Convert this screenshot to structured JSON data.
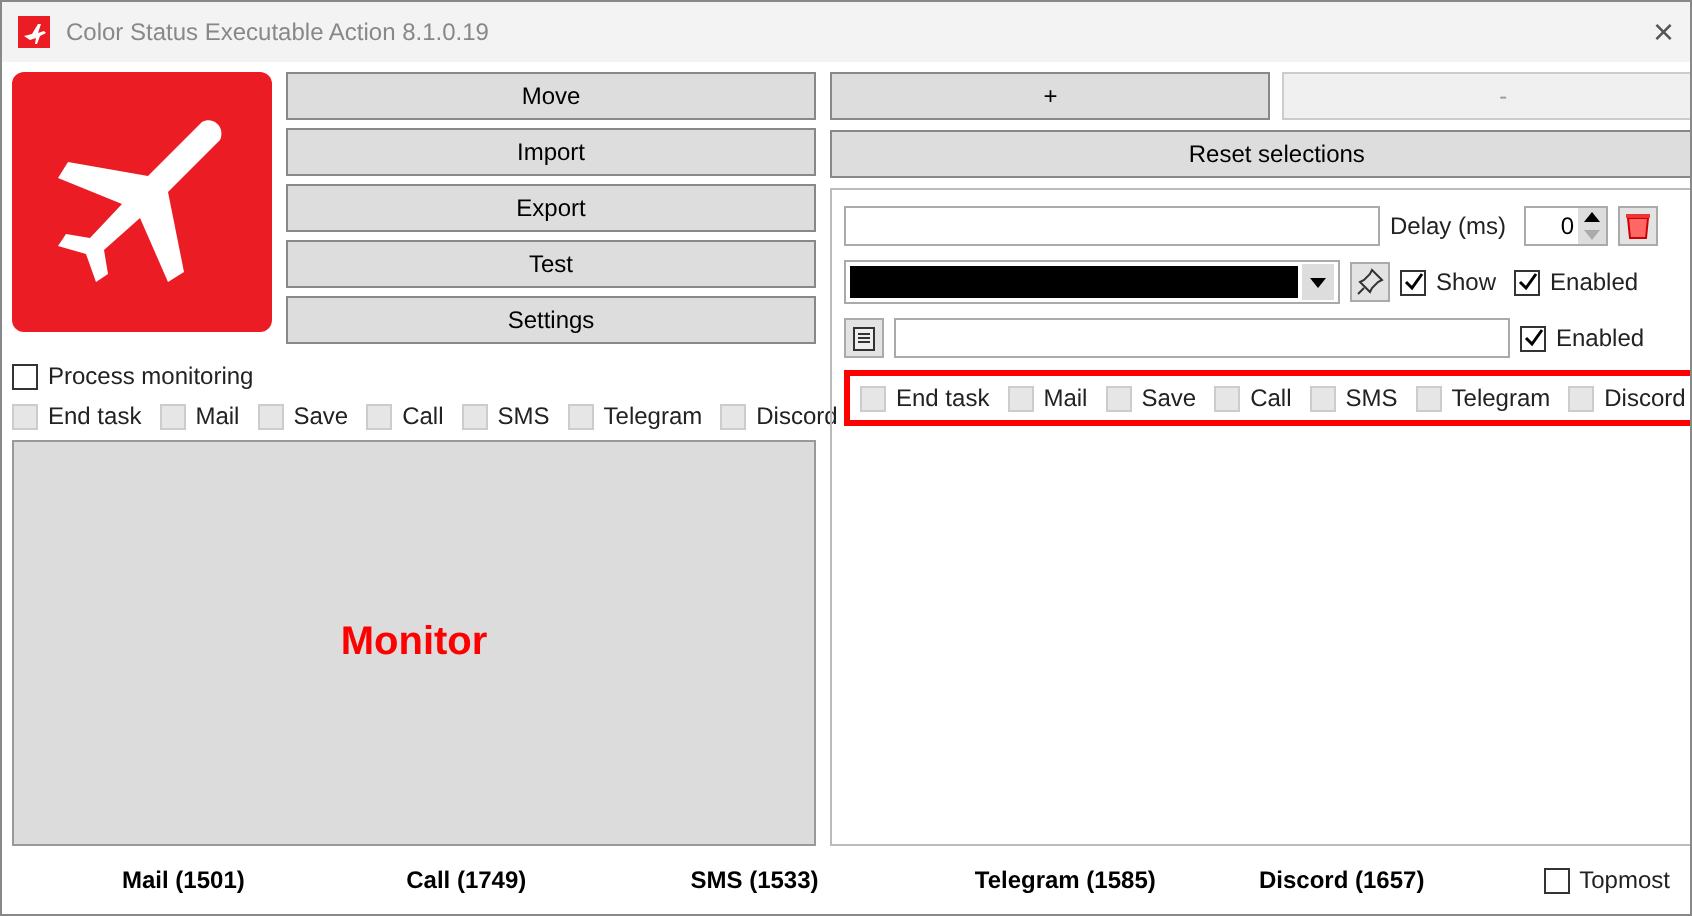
{
  "window": {
    "title": "Color Status Executable Action 8.1.0.19",
    "close": "×"
  },
  "buttons": [
    {
      "label": "Move"
    },
    {
      "label": "Import"
    },
    {
      "label": "Export"
    },
    {
      "label": "Test"
    },
    {
      "label": "Settings"
    }
  ],
  "process_monitoring": {
    "label": "Process monitoring",
    "checked": false
  },
  "left_channels": [
    {
      "label": "End task",
      "checked": false,
      "disabled": true
    },
    {
      "label": "Mail",
      "checked": false,
      "disabled": true
    },
    {
      "label": "Save",
      "checked": false,
      "disabled": true
    },
    {
      "label": "Call",
      "checked": false,
      "disabled": true
    },
    {
      "label": "SMS",
      "checked": false,
      "disabled": true
    },
    {
      "label": "Telegram",
      "checked": false,
      "disabled": true
    },
    {
      "label": "Discord",
      "checked": false,
      "disabled": true
    }
  ],
  "monitor": {
    "label": "Monitor"
  },
  "add_button": {
    "label": "+",
    "disabled": false
  },
  "remove_button": {
    "label": "-",
    "disabled": true
  },
  "reset_button": {
    "label": "Reset selections"
  },
  "action": {
    "delay_label": "Delay (ms)",
    "delay_value": "0",
    "color": "#000000",
    "show": {
      "label": "Show",
      "checked": true
    },
    "enabled_color": {
      "label": "Enabled",
      "checked": true
    },
    "enabled_path": {
      "label": "Enabled",
      "checked": true
    },
    "channels": [
      {
        "label": "End task",
        "checked": false,
        "disabled": true
      },
      {
        "label": "Mail",
        "checked": false,
        "disabled": true
      },
      {
        "label": "Save",
        "checked": false,
        "disabled": true
      },
      {
        "label": "Call",
        "checked": false,
        "disabled": true
      },
      {
        "label": "SMS",
        "checked": false,
        "disabled": true
      },
      {
        "label": "Telegram",
        "checked": false,
        "disabled": true
      },
      {
        "label": "Discord",
        "checked": false,
        "disabled": true
      }
    ]
  },
  "counters": [
    {
      "label": "Mail (1501)"
    },
    {
      "label": "Call (1749)"
    },
    {
      "label": "SMS (1533)"
    },
    {
      "label": "Telegram (1585)"
    },
    {
      "label": "Discord (1657)"
    }
  ],
  "topmost": {
    "label": "Topmost",
    "checked": false
  }
}
